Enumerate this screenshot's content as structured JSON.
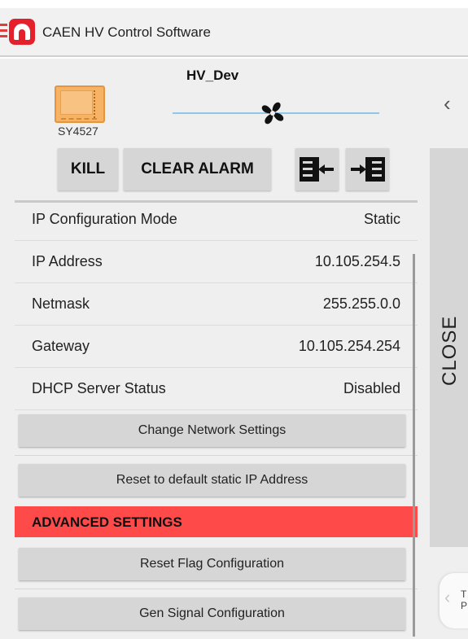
{
  "app": {
    "title": "CAEN HV Control Software"
  },
  "device": {
    "name": "HV_Dev",
    "model": "SY4527"
  },
  "controls": {
    "kill_label": "KILL",
    "clear_alarm_label": "CLEAR ALARM",
    "close_label": "CLOSE"
  },
  "settings": [
    {
      "label": "IP Configuration Mode",
      "value": "Static"
    },
    {
      "label": "IP Address",
      "value": "10.105.254.5"
    },
    {
      "label": "Netmask",
      "value": "255.255.0.0"
    },
    {
      "label": "Gateway",
      "value": "10.105.254.254"
    },
    {
      "label": "DHCP Server Status",
      "value": "Disabled"
    }
  ],
  "actions": {
    "change_network": "Change Network Settings",
    "reset_static_ip": "Reset to default static IP Address",
    "advanced_header": "ADVANCED SETTINGS",
    "reset_flag": "Reset Flag Configuration",
    "gen_signal": "Gen Signal Configuration"
  },
  "peek_tab": {
    "line1": "T",
    "line2": "P"
  },
  "colors": {
    "brand_red": "#e3202b",
    "advanced_header_bg": "#ff4a4a",
    "fan_line": "#8fc7e8",
    "crate_orange": "#f6b366"
  }
}
